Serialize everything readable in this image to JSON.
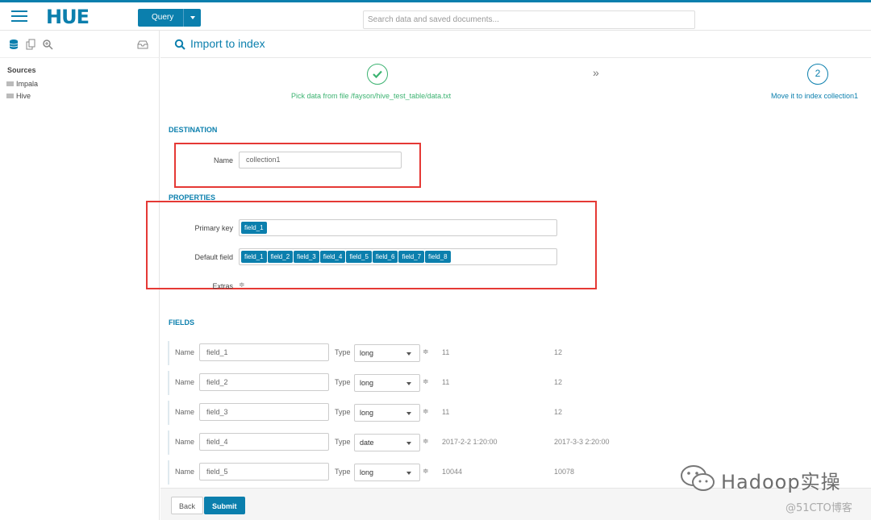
{
  "topbar": {
    "logo": "HUE",
    "query_label": "Query",
    "search_placeholder": "Search data and saved documents..."
  },
  "sidebar": {
    "sources_title": "Sources",
    "items": [
      {
        "label": "Impala"
      },
      {
        "label": "Hive"
      }
    ]
  },
  "page": {
    "title": "Import to index"
  },
  "steps": [
    {
      "number": "",
      "label": "Pick data from file /fayson/hive_test_table/data.txt",
      "done": true
    },
    {
      "number": "2",
      "label": "Move it to index collection1",
      "done": false
    }
  ],
  "destination": {
    "heading": "DESTINATION",
    "name_label": "Name",
    "name_value": "collection1"
  },
  "properties": {
    "heading": "PROPERTIES",
    "primary_key_label": "Primary key",
    "primary_key_tags": [
      "field_1"
    ],
    "default_field_label": "Default field",
    "default_field_tags": [
      "field_1",
      "field_2",
      "field_3",
      "field_4",
      "field_5",
      "field_6",
      "field_7",
      "field_8"
    ],
    "extras_label": "Extras"
  },
  "fields": {
    "heading": "FIELDS",
    "name_label": "Name",
    "type_label": "Type",
    "rows": [
      {
        "name": "field_1",
        "type": "long",
        "sample1": "11",
        "sample2": "12"
      },
      {
        "name": "field_2",
        "type": "long",
        "sample1": "11",
        "sample2": "12"
      },
      {
        "name": "field_3",
        "type": "long",
        "sample1": "11",
        "sample2": "12"
      },
      {
        "name": "field_4",
        "type": "date",
        "sample1": "2017-2-2 1:20:00",
        "sample2": "2017-3-3 2:20:00"
      },
      {
        "name": "field_5",
        "type": "long",
        "sample1": "10044",
        "sample2": "10078"
      }
    ]
  },
  "footer": {
    "back_label": "Back",
    "submit_label": "Submit"
  },
  "watermark": {
    "text": "Hadoop实操",
    "sub": "@51CTO博客"
  },
  "colors": {
    "accent": "#0B7FAD",
    "success": "#3cb371",
    "highlight": "#e53935"
  }
}
